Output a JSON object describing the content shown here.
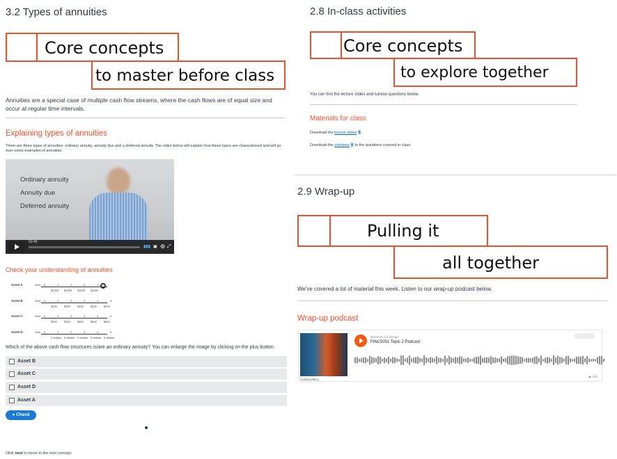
{
  "left": {
    "section_title": "3.2 Types of annuities",
    "banner": {
      "line1": "Core concepts",
      "line2": "to master before class"
    },
    "intro": "Annuities are a special case of multiple cash flow streams, where the cash flows are of equal size and occur at regular time intervals.",
    "explain_heading": "Explaining types of annuities",
    "explain_text": "There are three types of annuities: ordinary annuity, annuity due and a deferred annuity. The video below will explain how these types are characterised and will go over some examples of annuities.",
    "video": {
      "items": [
        "Ordinary annuity",
        "Annuity due",
        "Deferred annuity"
      ],
      "time": "02:49"
    },
    "check_heading": "Check your understanding of annuities",
    "assets": [
      {
        "label": "Asset A",
        "year": "Year",
        "nums": [
          "0",
          "1",
          "2",
          "3",
          "4"
        ],
        "vals": [
          "$1000",
          "$1000",
          "$1000",
          "$1000"
        ]
      },
      {
        "label": "Asset B",
        "year": "Year",
        "nums": [
          "0",
          "1",
          "2",
          "3",
          "4",
          "5"
        ],
        "vals": [
          "$200",
          "$200",
          "$200",
          "$200",
          "$200"
        ]
      },
      {
        "label": "Asset C",
        "year": "Year",
        "nums": [
          "0",
          "1",
          "2",
          "3",
          "4",
          "5"
        ],
        "vals": [
          "$200",
          "$300",
          "$400",
          "$500",
          "$600"
        ]
      },
      {
        "label": "Asset D",
        "year": "Year",
        "nums": [
          "0",
          "1",
          "2",
          "3",
          "4",
          "5"
        ],
        "vals": [
          "0 dollars",
          "0 dollars",
          "0 dollars",
          "0 dollars",
          "0 dollars"
        ]
      }
    ],
    "question": "Which of the above cash flow structures is/are an ordinary annuity? You can enlarge the image by clicking on the plus button.",
    "options": [
      "Asset B",
      "Asset C",
      "Asset D",
      "Asset A"
    ],
    "check_button": "Check",
    "footer_pre": "Click ",
    "footer_bold": "next",
    "footer_post": " to move to the next concept."
  },
  "right_top": {
    "section_title": "2.8 In-class activities",
    "banner": {
      "line1": "Core concepts",
      "line2": "to explore together"
    },
    "intro": "You can find the lecture slides and tutorial questions below.",
    "materials_heading": "Materials for class",
    "download1_pre": "Download the ",
    "download1_link": "lecture slides",
    "download1_post": " .",
    "download2_pre": "Download the ",
    "download2_link": "solutions",
    "download2_post": " to the questions covered in class."
  },
  "right_bottom": {
    "section_title": "2.9 Wrap-up",
    "banner": {
      "line1": "Pulling it",
      "line2": "all together"
    },
    "intro": "We've covered a lot of material this week. Listen to our wrap-up podcast below.",
    "podcast_heading": "Wrap-up podcast",
    "podcast": {
      "publisher": "Business Co-Design",
      "title": "FINC5001 Topic 2 Podcast",
      "caption": "Cookie policy",
      "plays": "▶ 432"
    }
  },
  "colors": {
    "accent": "#ee4f2b",
    "link": "#0770a3",
    "check": "#1c79d4",
    "soundcloud": "#f55a12"
  }
}
